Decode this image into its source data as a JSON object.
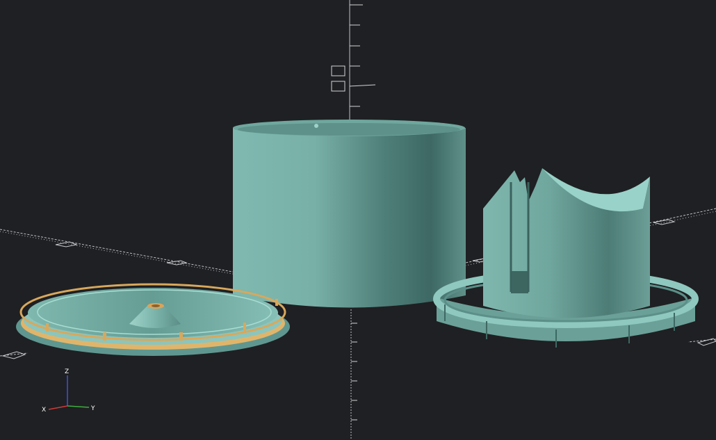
{
  "app": {
    "background_color": "#1f2023",
    "model_color": "#82bcb3",
    "accent_color": "#e0b56a"
  },
  "viewport": {
    "axes_gizmo": {
      "x_label": "X",
      "y_label": "Y",
      "z_label": "Z",
      "x_color": "#d23a3a",
      "y_color": "#3fae3f",
      "z_color": "#3b55d9"
    },
    "objects": [
      "round-lid",
      "cylinder-canister",
      "slotted-insert-with-ring"
    ]
  }
}
